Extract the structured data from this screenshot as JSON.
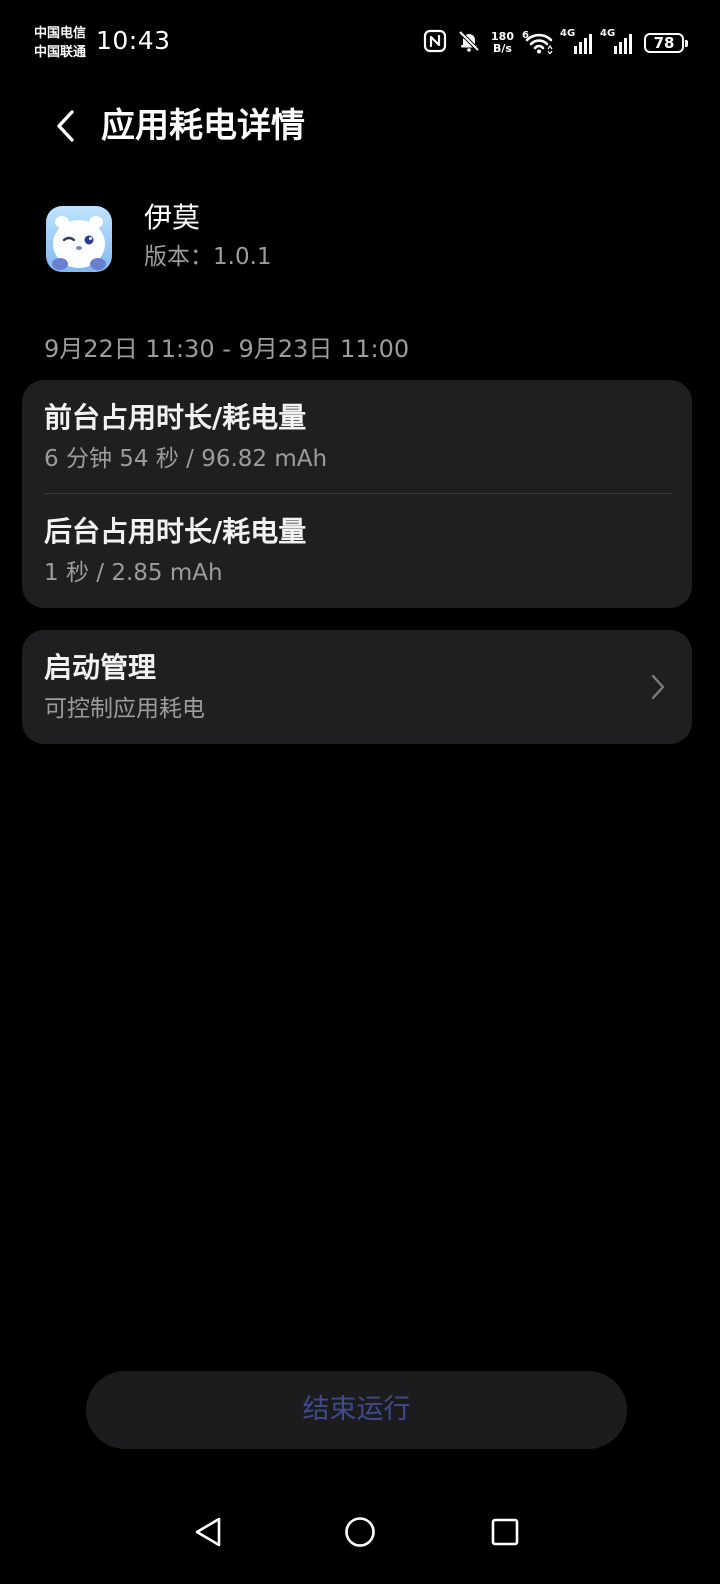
{
  "status_bar": {
    "carrier_1": "中国电信",
    "carrier_2": "中国联通",
    "time": "10:43",
    "net_speed_value": "180",
    "net_speed_unit": "B/s",
    "wifi_label": "6",
    "signal_1_label": "4G",
    "signal_2_label": "4G",
    "battery_level": "78",
    "icons": [
      "nfc-icon",
      "bell-muted-icon",
      "wifi-icon",
      "signal-icon",
      "signal-icon",
      "battery-icon"
    ]
  },
  "header": {
    "title": "应用耗电详情",
    "back_icon": "chevron-left-icon"
  },
  "app": {
    "name": "伊莫",
    "version": "版本：1.0.1",
    "icon": "app-icon"
  },
  "time_range": "9月22日 11:30 - 9月23日 11:00",
  "usage": {
    "foreground_title": "前台占用时长/耗电量",
    "foreground_value": "6 分钟 54 秒 / 96.82 mAh",
    "background_title": "后台占用时长/耗电量",
    "background_value": "1 秒 / 2.85 mAh"
  },
  "startup": {
    "title": "启动管理",
    "subtitle": "可控制应用耗电",
    "chevron_icon": "chevron-right-icon"
  },
  "end_button": {
    "label": "结束运行"
  },
  "nav": {
    "back_icon": "triangle-back-icon",
    "home_icon": "circle-home-icon",
    "recent_icon": "square-recent-icon"
  },
  "colors": {
    "background": "#000000",
    "card": "#1f1f21",
    "secondary_text": "#9c9c9c",
    "end_button_text": "#3e4a8c"
  }
}
